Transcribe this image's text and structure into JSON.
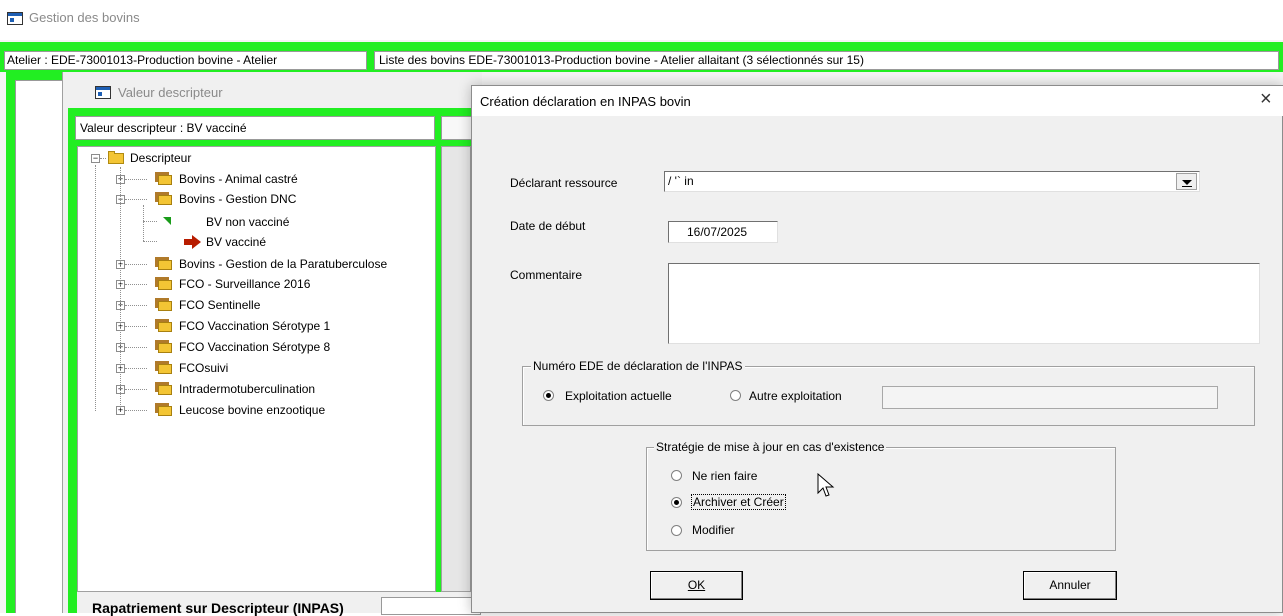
{
  "main_window": {
    "title": "Gestion des bovins"
  },
  "header": {
    "atelier_label": "Atelier : EDE-73001013-Production bovine - Atelier",
    "liste_label": "Liste des bovins EDE-73001013-Production bovine - Atelier allaitant (3 sélectionnés sur 15)"
  },
  "valeur_window": {
    "title": "Valeur descripteur",
    "descriptor_label": "Valeur descripteur : BV vacciné",
    "tree": {
      "root": "Descripteur",
      "items": [
        {
          "label": "Bovins - Animal castré",
          "expanded": false
        },
        {
          "label": "Bovins - Gestion DNC",
          "expanded": true,
          "children": [
            {
              "label": "BV non vacciné"
            },
            {
              "label": "BV vacciné"
            }
          ]
        },
        {
          "label": "Bovins - Gestion de la Paratuberculose",
          "expanded": false
        },
        {
          "label": "FCO - Surveillance 2016",
          "expanded": false
        },
        {
          "label": "FCO Sentinelle",
          "expanded": false
        },
        {
          "label": "FCO Vaccination Sérotype 1",
          "expanded": false
        },
        {
          "label": "FCO Vaccination Sérotype 8",
          "expanded": false
        },
        {
          "label": "FCOsuivi",
          "expanded": false
        },
        {
          "label": "Intradermotuberculination",
          "expanded": false
        },
        {
          "label": "Leucose bovine enzootique",
          "expanded": false
        }
      ]
    },
    "bottom_label": "Rapatriement sur Descripteur (INPAS)"
  },
  "dialog": {
    "title": "Création déclaration en INPAS bovin",
    "close_symbol": "×",
    "declarant_label": "Déclarant ressource",
    "declarant_value": "/ '`            in",
    "date_label": "Date de début",
    "date_value": "16/07/2025",
    "commentaire_label": "Commentaire",
    "commentaire_value": "",
    "ede_group": {
      "title": "Numéro EDE de déclaration de l'INPAS",
      "option1": "Exploitation actuelle",
      "option2": "Autre exploitation",
      "selected": "Exploitation actuelle",
      "other_value": ""
    },
    "strategy_group": {
      "title": "Stratégie de mise à jour en cas d'existence",
      "options": [
        "Ne rien faire",
        "Archiver et Créer",
        "Modifier"
      ],
      "selected": "Archiver et Créer"
    },
    "ok_label": "OK",
    "cancel_label": "Annuler"
  },
  "colors": {
    "highlight_green": "#22ee22",
    "dialog_bg": "#f0f0f0",
    "folder": "#f3c534"
  },
  "icons": [
    "window-icon",
    "folder-icon",
    "folder-stack-icon",
    "green-triangle-icon",
    "red-arrow-icon",
    "combo-arrow-icon",
    "mouse-cursor-icon"
  ]
}
